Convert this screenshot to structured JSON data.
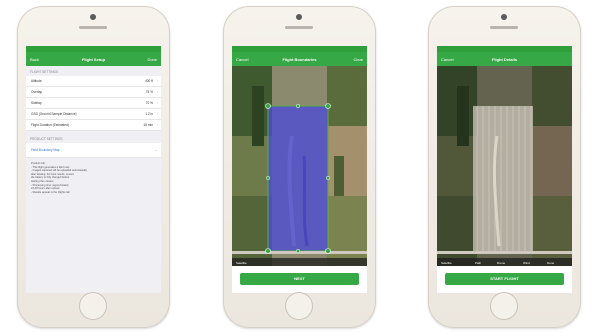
{
  "phone1": {
    "nav": {
      "back": "Back",
      "title": "Flight Setup",
      "right": "Done"
    },
    "section_a": "FLIGHT SETTINGS",
    "rows": [
      {
        "label": "Altitude",
        "value": "400 ft"
      },
      {
        "label": "Overlap",
        "value": "75 %"
      },
      {
        "label": "Sidelap",
        "value": "70 %"
      },
      {
        "label": "GSD (Ground Sample Distance)",
        "value": "1.2 in"
      },
      {
        "label": "Flight Duration (Estimated)",
        "value": "18 min"
      }
    ],
    "section_b": "PRODUCT SETTINGS",
    "link_row": "Field Boundary Map",
    "notes": [
      "Product Info:",
      "- This flight generates a field map",
      "- Images captured will be uploaded automatically",
      "  after landing. For best results, ensure",
      "  the battery is fully charged before",
      "  starting the mission.",
      "",
      "- Processing time: approximately",
      "  24-48 hours after upload",
      "- Results appear in the Flights tab"
    ]
  },
  "phone2": {
    "nav": {
      "left": "Cancel",
      "title": "Flight Boundaries",
      "right": "Clear"
    },
    "bottom_left": "Satellite",
    "button": "NEXT"
  },
  "phone3": {
    "nav": {
      "left": "Cancel",
      "title": "Flight Details",
      "right": ""
    },
    "tools": [
      "Satellite",
      "Path",
      "Drone",
      "Wind",
      "Done"
    ],
    "button": "START FLIGHT"
  },
  "colors": {
    "brand_green": "#36a845",
    "overlay_blue": "#4b4bd6"
  }
}
